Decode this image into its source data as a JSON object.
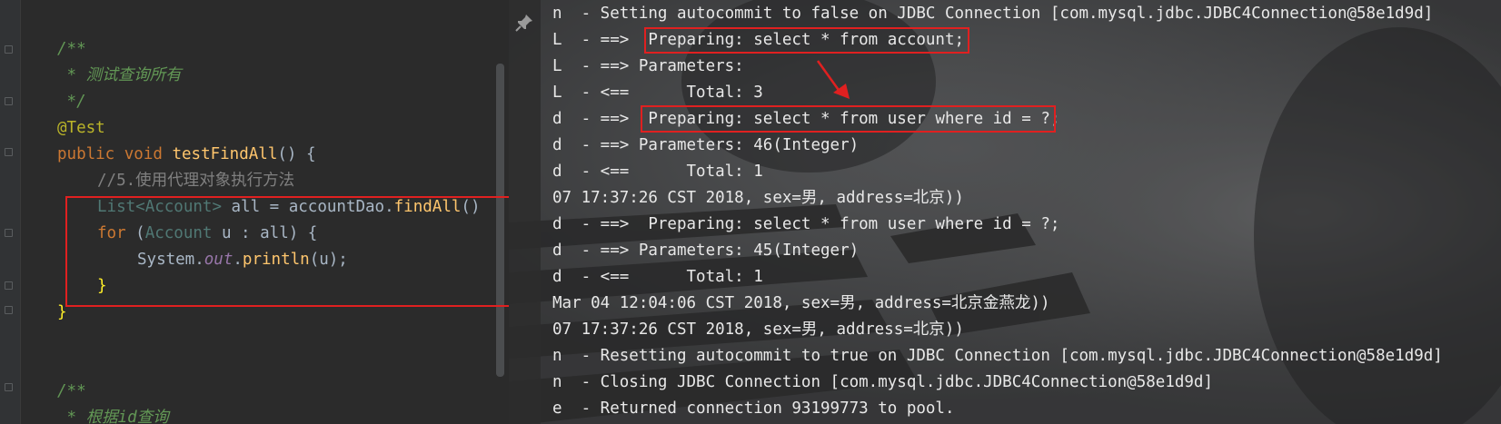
{
  "editor": {
    "lines": [
      "/**",
      " * 测试查询所有",
      " */",
      "@Test",
      "public void testFindAll() {",
      "//5.使用代理对象执行方法",
      "List<Account> all = accountDao.findAll()",
      "for (Account u : all) {",
      "System.out.println(u);",
      "}",
      "}",
      "",
      "",
      "/**",
      " * 根据id查询"
    ]
  },
  "console": {
    "lines": [
      "n  - Setting autocommit to false on JDBC Connection [com.mysql.jdbc.JDBC4Connection@58e1d9d]",
      "L  - ==>  Preparing: select * from account;",
      "L  - ==> Parameters:",
      "L  - <==      Total: 3",
      "d  - ==>  Preparing: select * from user where id = ?;",
      "d  - ==> Parameters: 46(Integer)",
      "d  - <==      Total: 1",
      "07 17:37:26 CST 2018, sex=男, address=北京))",
      "d  - ==>  Preparing: select * from user where id = ?;",
      "d  - ==> Parameters: 45(Integer)",
      "d  - <==      Total: 1",
      "Mar 04 12:04:06 CST 2018, sex=男, address=北京金燕龙))",
      "07 17:37:26 CST 2018, sex=男, address=北京))",
      "n  - Resetting autocommit to true on JDBC Connection [com.mysql.jdbc.JDBC4Connection@58e1d9d]",
      "n  - Closing JDBC Connection [com.mysql.jdbc.JDBC4Connection@58e1d9d]",
      "e  - Returned connection 93199773 to pool."
    ]
  },
  "icons": {
    "pin": "pin-icon",
    "fold": "fold-marker-icon"
  },
  "colors": {
    "highlight_box": "#e02020",
    "editor_bg": "#2b2b2b"
  }
}
